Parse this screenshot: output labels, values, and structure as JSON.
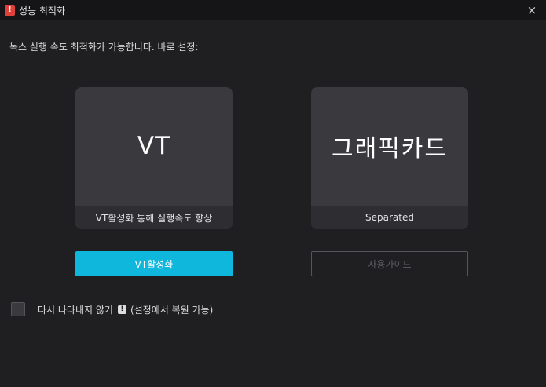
{
  "window": {
    "title": "성능 최적화",
    "title_icon": "alert-icon",
    "title_icon_glyph": "!",
    "close_glyph": "×"
  },
  "description": "녹스 실행 속도 최적화가 가능합니다. 바로 설정:",
  "cards": {
    "vt": {
      "main": "VT",
      "footer": "VT활성화 통해 실행속도 향상"
    },
    "gpu": {
      "main": "그래픽카드",
      "footer": "Separated"
    }
  },
  "buttons": {
    "vt_enable": "VT활성화",
    "user_guide": "사용가이드"
  },
  "dont_show": {
    "label": "다시 나타내지 않기",
    "info_glyph": "!",
    "note": "(설정에서 복원 가능)",
    "checked": false
  },
  "colors": {
    "accent": "#0fb7dc",
    "alert": "#e0403a",
    "background": "#1f1f22",
    "card": "#3a393e"
  }
}
